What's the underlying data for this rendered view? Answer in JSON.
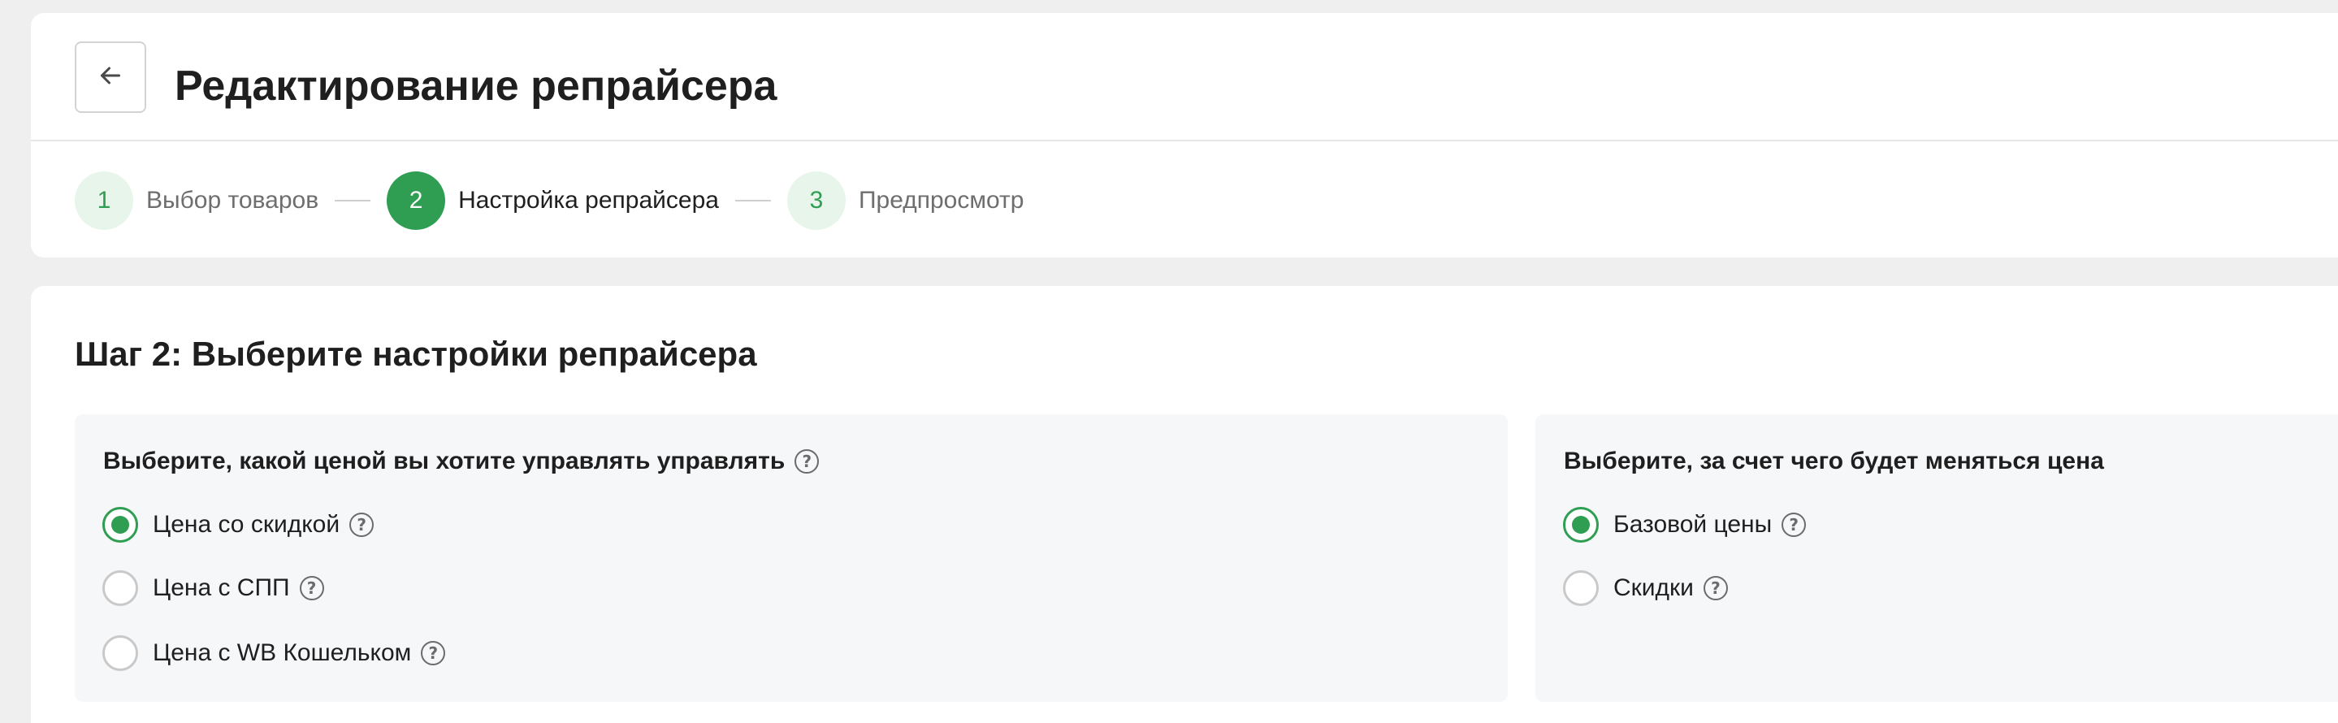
{
  "header": {
    "title": "Редактирование репрайсера"
  },
  "stepper": {
    "steps": [
      {
        "number": "1",
        "label": "Выбор товаров",
        "state": "done"
      },
      {
        "number": "2",
        "label": "Настройка репрайсера",
        "state": "active"
      },
      {
        "number": "3",
        "label": "Предпросмотр",
        "state": "upcoming"
      }
    ]
  },
  "main": {
    "section_title": "Шаг 2: Выберите настройки репрайсера",
    "price_type": {
      "title": "Выберите, какой ценой вы хотите управлять управлять",
      "options": [
        {
          "label": "Цена со скидкой",
          "checked": true
        },
        {
          "label": "Цена с СПП",
          "checked": false
        },
        {
          "label": "Цена с WB Кошельком",
          "checked": false
        }
      ]
    },
    "change_source": {
      "title": "Выберите, за счет чего будет меняться цена",
      "options": [
        {
          "label": "Базовой цены",
          "checked": true
        },
        {
          "label": "Скидки",
          "checked": false
        }
      ]
    }
  },
  "icons": {
    "help": "?"
  },
  "colors": {
    "accent": "#2f9e52",
    "accent_light": "#e7f5ea",
    "page_bg": "#efefef",
    "panel_bg": "#f6f7f9"
  }
}
